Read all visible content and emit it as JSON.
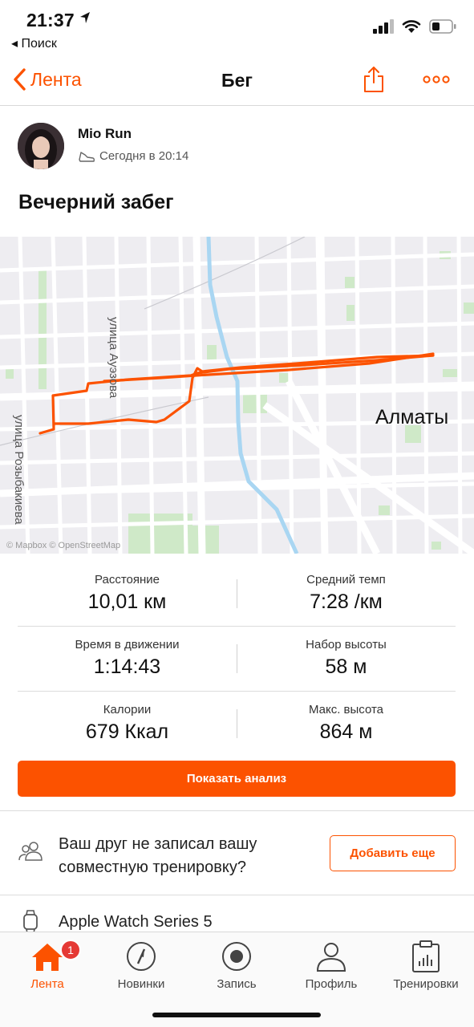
{
  "status_bar": {
    "time": "21:37",
    "back_app": "◂ Поиск"
  },
  "nav": {
    "back_label": "Лента",
    "title": "Бег"
  },
  "athlete": {
    "name": "Mio Run",
    "date": "Сегодня в 20:14"
  },
  "activity": {
    "title": "Вечерний забег"
  },
  "map": {
    "city_label": "Алматы",
    "street_1": "улица Ауэзова",
    "street_2": "улица Розыбакиева",
    "attribution": "© Mapbox © OpenStreetMap",
    "route_color": "#fc5200"
  },
  "stats": [
    {
      "left": {
        "label": "Расстояние",
        "value": "10,01 км"
      },
      "right": {
        "label": "Средний темп",
        "value": "7:28 /км"
      }
    },
    {
      "left": {
        "label": "Время в движении",
        "value": "1:14:43"
      },
      "right": {
        "label": "Набор высоты",
        "value": "58 м"
      }
    },
    {
      "left": {
        "label": "Калории",
        "value": "679 Ккал"
      },
      "right": {
        "label": "Макс. высота",
        "value": "864 м"
      }
    }
  ],
  "analysis_button": "Показать анализ",
  "friend_prompt": {
    "text": "Ваш друг не записал вашу совместную тренировку?",
    "button": "Добавить еще"
  },
  "device": {
    "name": "Apple Watch Series 5"
  },
  "tabs": [
    {
      "label": "Лента",
      "icon": "home-icon",
      "active": true,
      "badge": "1"
    },
    {
      "label": "Новинки",
      "icon": "compass-icon"
    },
    {
      "label": "Запись",
      "icon": "record-icon"
    },
    {
      "label": "Профиль",
      "icon": "profile-icon"
    },
    {
      "label": "Тренировки",
      "icon": "training-icon"
    }
  ],
  "colors": {
    "accent": "#fc5200",
    "badge": "#e53935"
  }
}
